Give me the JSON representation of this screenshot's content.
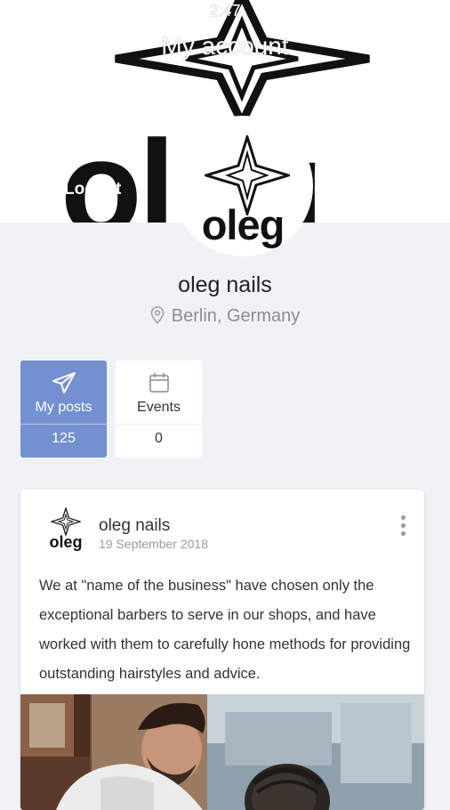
{
  "status": {
    "time": "2:47"
  },
  "cover": {
    "title": "My account",
    "wordmark": "oleg",
    "logout_label": "Logout"
  },
  "profile": {
    "avatar_word": "oleg",
    "name": "oleg nails",
    "location": "Berlin, Germany"
  },
  "tabs": [
    {
      "label": "My posts",
      "count": "125",
      "icon": "paper-plane-icon",
      "active": true
    },
    {
      "label": "Events",
      "count": "0",
      "icon": "calendar-icon",
      "active": false
    }
  ],
  "post": {
    "avatar_word": "oleg",
    "author": "oleg nails",
    "date": "19 September 2018",
    "text": "We at \"name of the business\" have chosen only the exceptional barbers to serve in our shops, and have worked with them to carefully hone methods for providing outstanding hairstyles and advice."
  },
  "colors": {
    "accent": "#7490d0",
    "page_bg": "#f0f2f6",
    "muted_text": "#8a8d93"
  }
}
